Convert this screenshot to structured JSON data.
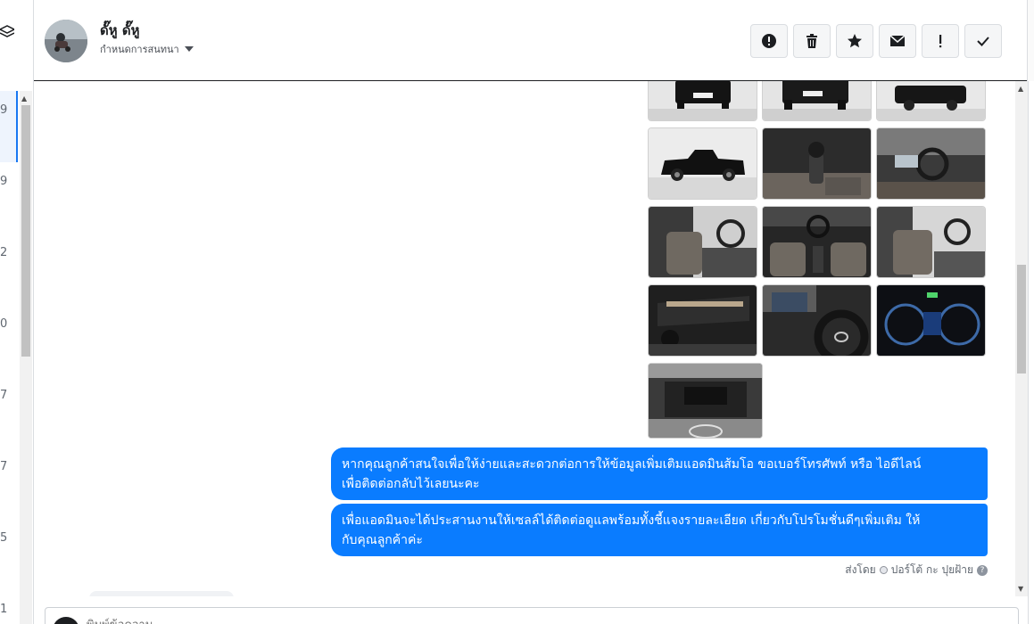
{
  "list_edge": {
    "numbers": [
      "9",
      "9",
      "2",
      "0",
      "7",
      "7",
      "5",
      "1"
    ]
  },
  "contact": {
    "name": "ดั๊หู ดั๊หู",
    "assign_label": "กำหนดการสนทนา"
  },
  "actions": [
    {
      "name": "mark-spam",
      "icon": "alert-circle-icon"
    },
    {
      "name": "delete",
      "icon": "trash-icon"
    },
    {
      "name": "star",
      "icon": "star-icon"
    },
    {
      "name": "unread",
      "icon": "envelope-icon"
    },
    {
      "name": "priority",
      "icon": "exclamation-icon"
    },
    {
      "name": "done",
      "icon": "check-icon"
    }
  ],
  "messages": [
    {
      "text_line1": "หากคุณลูกค้าสนใจเพื่อให้ง่ายและสะดวกต่อการให้ข้อมูลเพิ่มเติมแอดมินส้มโอ ขอเบอร์โทรศัพท์ หรือ ไอดีไลน์",
      "text_line2": "เพื่อติดต่อกลับไว้เลยนะคะ"
    },
    {
      "text_line1": "เพื่อแอดมินจะได้ประสานงานให้เซลล์ได้ติดต่อดูแลพร้อมทั้งชี้แจงรายละเอียด เกี่ยวกับโปรโมชั่นดีๆเพิ่มเติม ให้",
      "text_line2": "กับคุณลูกค้าค่ะ"
    }
  ],
  "sent_by": {
    "prefix": "ส่งโดย",
    "sender": "ปอร์โต้ กะ ปุยฝ้าย"
  },
  "composer": {
    "placeholder": "พิมพ์ข้อความ..."
  },
  "colors": {
    "accent": "#0a7cff",
    "selection": "#1877f2"
  }
}
